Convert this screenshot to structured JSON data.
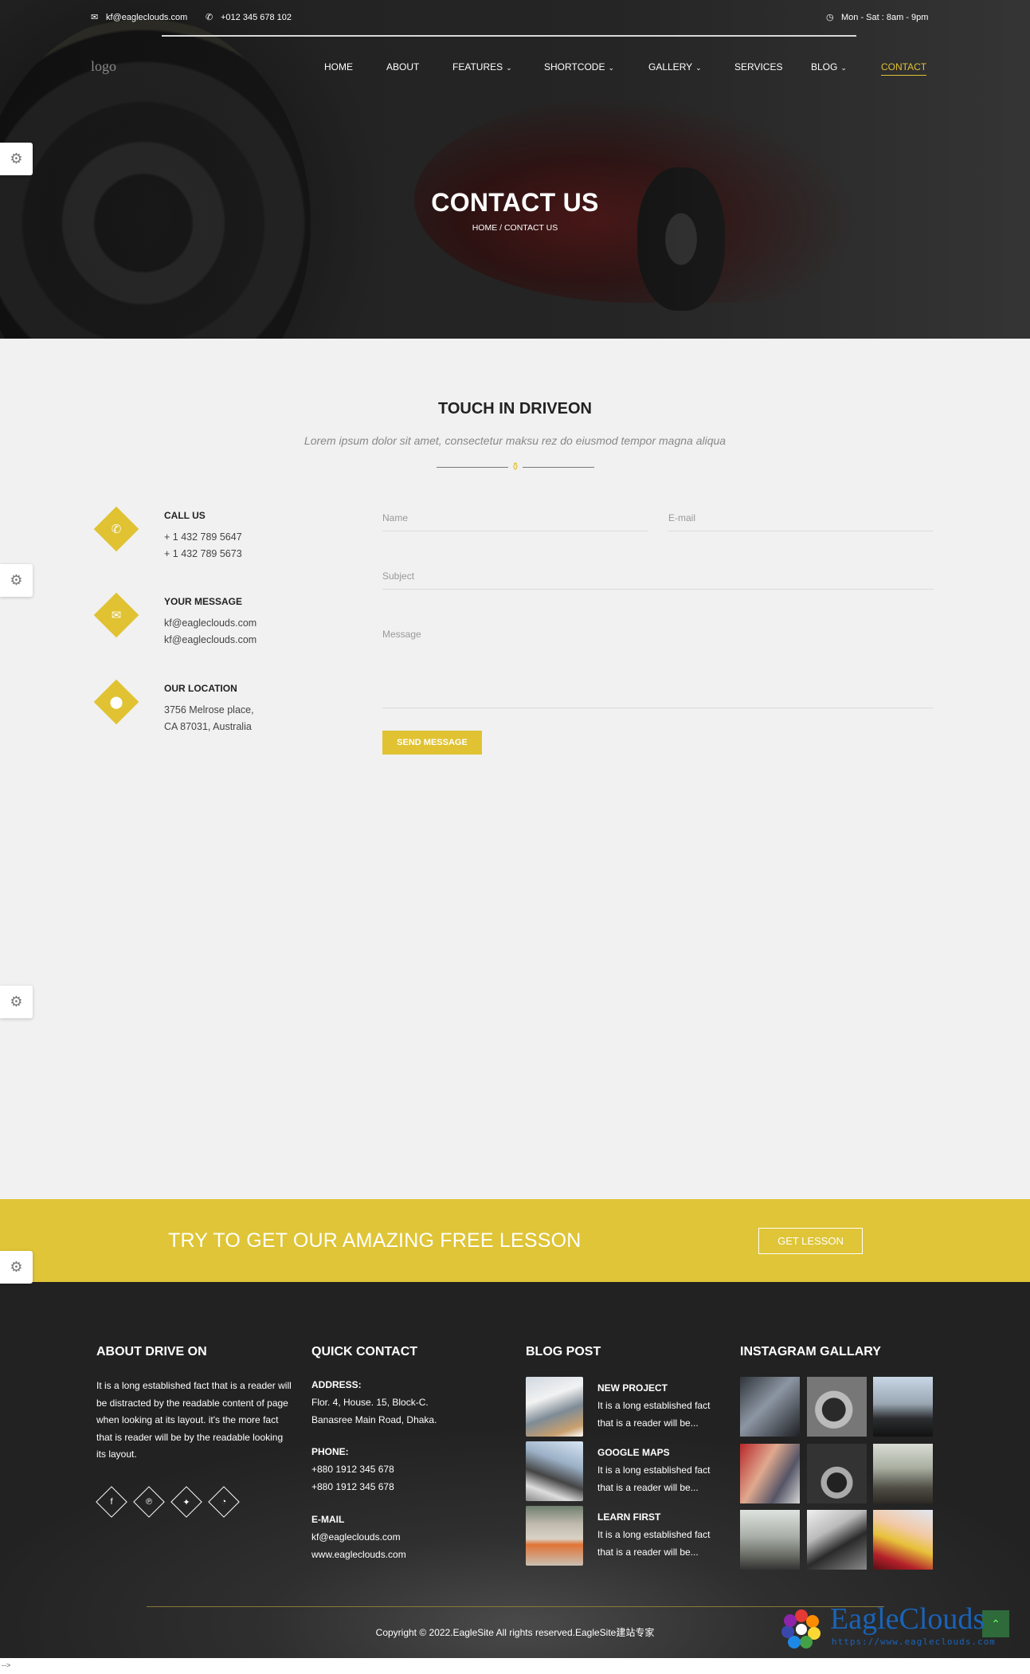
{
  "topbar": {
    "email": "kf@eagleclouds.com",
    "phone": "+012 345 678 102",
    "hours": "Mon - Sat : 8am - 9pm"
  },
  "logo_alt": "logo",
  "nav": {
    "items": [
      {
        "label": "HOME",
        "has_dropdown": false
      },
      {
        "label": "ABOUT",
        "has_dropdown": false
      },
      {
        "label": "FEATURES",
        "has_dropdown": true
      },
      {
        "label": "SHORTCODE",
        "has_dropdown": true
      },
      {
        "label": "GALLERY",
        "has_dropdown": true
      },
      {
        "label": "SERVICES",
        "has_dropdown": false
      },
      {
        "label": "BLOG",
        "has_dropdown": true
      },
      {
        "label": "CONTACT",
        "has_dropdown": false,
        "active": true
      }
    ]
  },
  "hero": {
    "title": "CONTACT US",
    "breadcrumb": "HOME / CONTACT US"
  },
  "contact": {
    "title": "TOUCH IN DRIVEON",
    "subtitle": "Lorem ipsum dolor sit amet, consectetur maksu rez do eiusmod tempor magna aliqua",
    "info": [
      {
        "icon": "phone-icon",
        "heading": "CALL US",
        "lines": [
          "+ 1 432 789 5647",
          "+ 1 432 789 5673"
        ]
      },
      {
        "icon": "envelope-icon",
        "heading": "YOUR MESSAGE",
        "lines": [
          "kf@eagleclouds.com",
          "kf@eagleclouds.com"
        ]
      },
      {
        "icon": "map-pin-icon",
        "heading": "OUR LOCATION",
        "lines": [
          "3756 Melrose place,",
          "CA 87031, Australia"
        ]
      }
    ],
    "form": {
      "name_placeholder": "Name",
      "email_placeholder": "E-mail",
      "subject_placeholder": "Subject",
      "message_placeholder": "Message",
      "submit_label": "SEND MESSAGE"
    }
  },
  "cta": {
    "text": "TRY TO GET OUR AMAZING FREE LESSON",
    "button": "GET LESSON"
  },
  "footer": {
    "about": {
      "title": "ABOUT DRIVE ON",
      "text": "It is a long established fact that is a reader will be distracted by the readable content of page when looking at its layout. it's the more fact that is reader will be by the readable looking its layout."
    },
    "social": [
      "facebook-icon",
      "pinterest-icon",
      "twitter-icon",
      "rss-icon"
    ],
    "quick_contact": {
      "title": "QUICK CONTACT",
      "address_label": "ADDRESS:",
      "address_lines": [
        "Flor. 4, House. 15, Block-C.",
        "Banasree Main Road, Dhaka."
      ],
      "phone_label": "PHONE:",
      "phone_lines": [
        "+880 1912 345 678",
        "+880 1912 345 678"
      ],
      "email_label": "E-MAIL",
      "email_lines": [
        "kf@eagleclouds.com",
        "www.eagleclouds.com"
      ]
    },
    "blog": {
      "title": "BLOG POST",
      "posts": [
        {
          "title": "NEW PROJECT",
          "line1": "It is a long established fact",
          "line2": "that is a reader will be..."
        },
        {
          "title": "GOOGLE MAPS",
          "line1": "It is a long established fact",
          "line2": "that is a reader will be..."
        },
        {
          "title": "LEARN FIRST",
          "line1": "It is a long established fact",
          "line2": "that is a reader will be..."
        }
      ]
    },
    "instagram": {
      "title": "INSTAGRAM GALLARY",
      "count": 9
    },
    "copyright": "Copyright © 2022.EagleSite All rights reserved.EagleSite建站专家"
  },
  "watermark": {
    "brand": "EagleClouds",
    "url": "https://www.eagleclouds.com"
  },
  "bottom_strip": "-->",
  "colors": {
    "accent": "#e0c232",
    "cta_bg": "#dfc537",
    "footer_bg": "#2b2b2b",
    "page_bg": "#f1f1f1"
  }
}
